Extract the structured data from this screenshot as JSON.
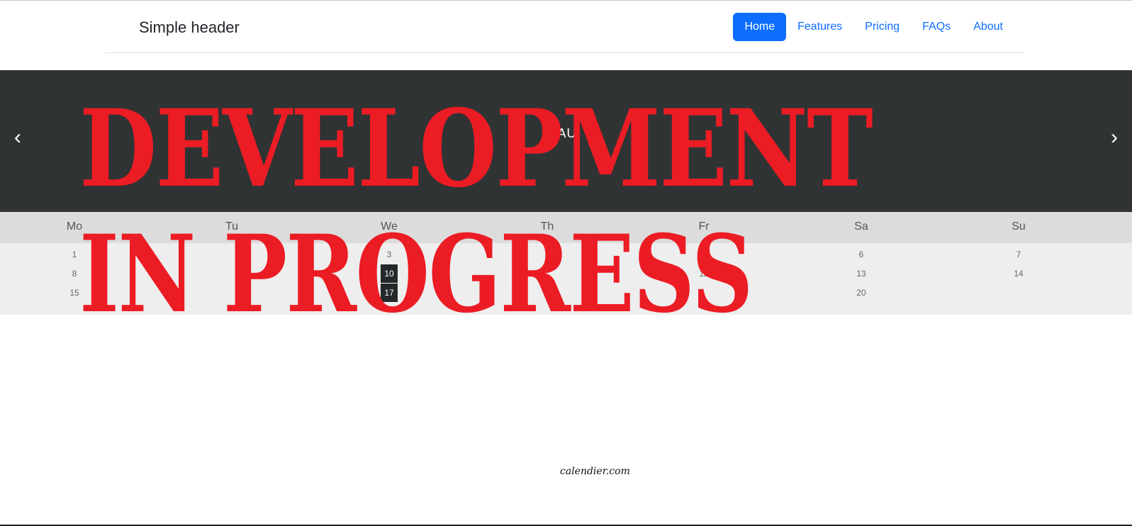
{
  "header": {
    "brand": "Simple header",
    "nav": [
      "Home",
      "Features",
      "Pricing",
      "FAQs",
      "About"
    ],
    "active": "Home"
  },
  "calendar": {
    "month_label": "AU",
    "prev_icon": "chevron-left-icon",
    "next_icon": "chevron-right-icon",
    "weekdays": [
      "Mo",
      "Tu",
      "We",
      "Th",
      "Fr",
      "Sa",
      "Su"
    ],
    "visible_days": {
      "row1": {
        "mo": "1",
        "we": "3",
        "sa": "6",
        "su": "7"
      },
      "row2": {
        "mo": "8",
        "we": "10",
        "fr": "12",
        "sa": "13",
        "su": "14"
      },
      "row3": {
        "mo": "15",
        "we": "17",
        "sa": "20"
      }
    },
    "selected_days": [
      "10",
      "17"
    ]
  },
  "watermark": {
    "line1": "DEVELOPMENT",
    "line2": "IN PROGRESS"
  },
  "footer": {
    "text": "calendier.com"
  },
  "colors": {
    "accent": "#0d6efd",
    "banner": "#303334",
    "watermark": "#ec1c24"
  }
}
